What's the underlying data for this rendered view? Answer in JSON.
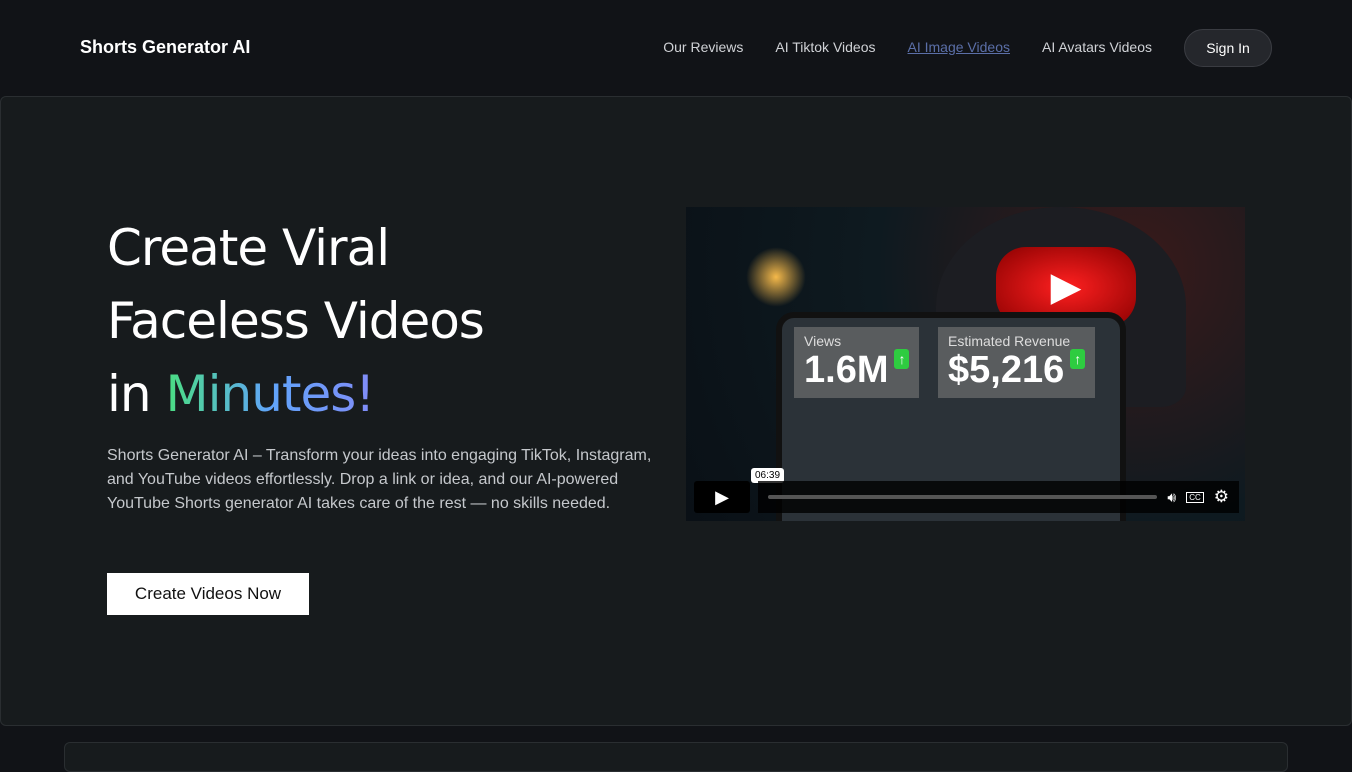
{
  "header": {
    "logo": "Shorts Generator AI",
    "nav": [
      "Our Reviews",
      "AI Tiktok Videos",
      "AI Image Videos",
      "AI Avatars Videos"
    ],
    "signin": "Sign In"
  },
  "hero": {
    "title_line1": "Create Viral",
    "title_line2": "Faceless Videos",
    "title_in": "in ",
    "title_highlight": "Minutes!",
    "description": "Shorts Generator AI – Transform your ideas into engaging TikTok, Instagram, and YouTube videos effortlessly. Drop a link or idea, and our AI-powered YouTube Shorts generator AI takes care of the rest — no skills needed.",
    "cta": "Create Videos Now"
  },
  "video": {
    "views_label": "Views",
    "views_value": "1.6M",
    "revenue_label": "Estimated Revenue",
    "revenue_value": "$5,216",
    "time_tooltip": "06:39"
  }
}
